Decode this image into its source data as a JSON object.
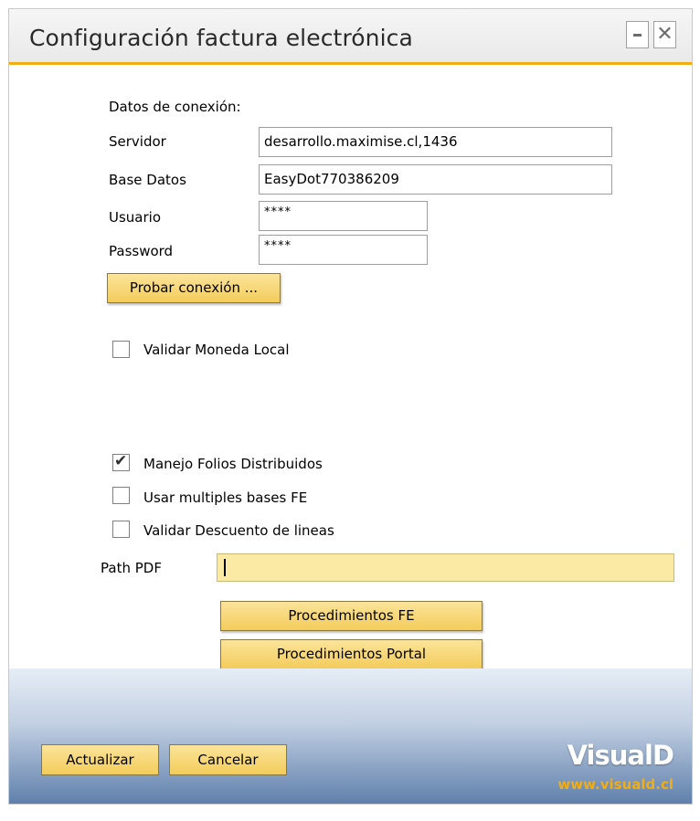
{
  "window": {
    "title": "Configuración factura electrónica"
  },
  "connection": {
    "section_label": "Datos de conexión:",
    "server_label": "Servidor",
    "server_value": "desarrollo.maximise.cl,1436",
    "database_label": "Base Datos",
    "database_value": "EasyDot770386209",
    "user_label": "Usuario",
    "user_value": "****",
    "password_label": "Password",
    "password_value": "****",
    "test_button": "Probar conexión ..."
  },
  "options": {
    "validar_moneda_local": {
      "label": "Validar Moneda Local",
      "checked": false
    },
    "manejo_folios": {
      "label": "Manejo Folios Distribuidos",
      "checked": true
    },
    "multiples_bases": {
      "label": "Usar multiples bases FE",
      "checked": false
    },
    "validar_descuento": {
      "label": "Validar Descuento de lineas",
      "checked": false
    }
  },
  "path_pdf": {
    "label": "Path PDF",
    "value": ""
  },
  "procedures": {
    "fe_button": "Procedimientos FE",
    "portal_button": "Procedimientos Portal"
  },
  "footer": {
    "update_button": "Actualizar",
    "cancel_button": "Cancelar",
    "brand_name": "VisualD",
    "brand_url": "www.visuald.cl"
  },
  "colors": {
    "accent": "#f0ad16",
    "button": "#f3cc5a",
    "path_field": "#fbeaa4"
  }
}
